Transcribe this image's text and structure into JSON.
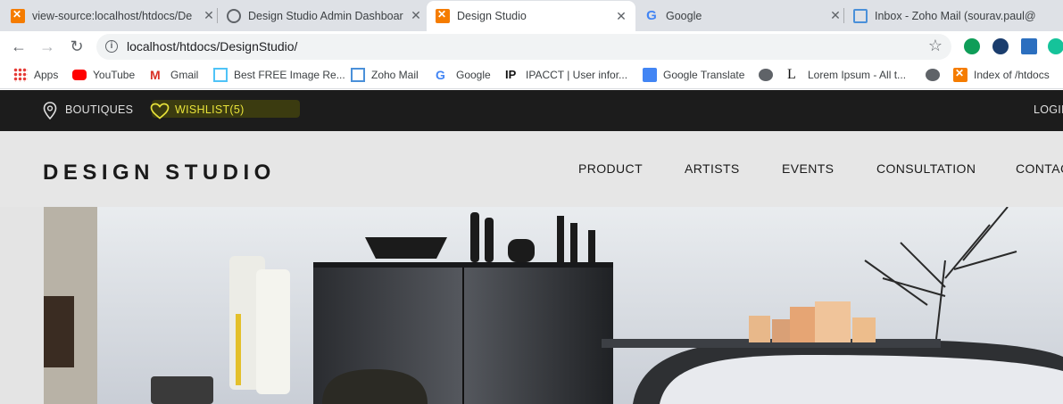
{
  "browser": {
    "tabs": [
      {
        "title": "view-source:localhost/htdocs/De",
        "icon": "xampp-icon",
        "active": false
      },
      {
        "title": "Design Studio Admin Dashboard",
        "icon": "globe-icon",
        "active": false
      },
      {
        "title": "Design Studio",
        "icon": "xampp-icon",
        "active": true
      },
      {
        "title": "Google",
        "icon": "google-icon",
        "active": false
      },
      {
        "title": "Inbox - Zoho Mail (sourav.paul@",
        "icon": "zoho-mail-icon",
        "active": false
      }
    ],
    "tab_close": "✕",
    "url": "localhost/htdocs/DesignStudio/",
    "bookmarks": [
      {
        "label": "Apps",
        "icon": "apps-grid-icon"
      },
      {
        "label": "YouTube",
        "icon": "youtube-icon"
      },
      {
        "label": "Gmail",
        "icon": "gmail-icon"
      },
      {
        "label": "Best FREE Image Re...",
        "icon": "image-icon"
      },
      {
        "label": "Zoho Mail",
        "icon": "zoho-mail-icon"
      },
      {
        "label": "Google",
        "icon": "google-icon"
      },
      {
        "label": "IPACCT | User infor...",
        "icon": "ipacct-icon"
      },
      {
        "label": "Google Translate",
        "icon": "google-translate-icon"
      },
      {
        "label": "",
        "icon": "globe-icon"
      },
      {
        "label": "Lorem Ipsum - All t...",
        "icon": "lorem-ipsum-icon"
      },
      {
        "label": "",
        "icon": "globe-icon"
      },
      {
        "label": "Index of /htdocs",
        "icon": "xampp-icon"
      }
    ]
  },
  "site": {
    "topbar": {
      "boutiques": "BOUTIQUES",
      "wishlist": "WISHLIST(5)",
      "login": "LOGIN"
    },
    "logo": "DESIGN STUDIO",
    "nav": [
      "PRODUCT",
      "ARTISTS",
      "EVENTS",
      "CONSULTATION",
      "CONTACT"
    ]
  },
  "colors": {
    "topbar_bg": "#1c1c1c",
    "wishlist_accent": "#e8e33a",
    "xampp_orange": "#f57c00",
    "header_bg": "#e6e6e6"
  }
}
